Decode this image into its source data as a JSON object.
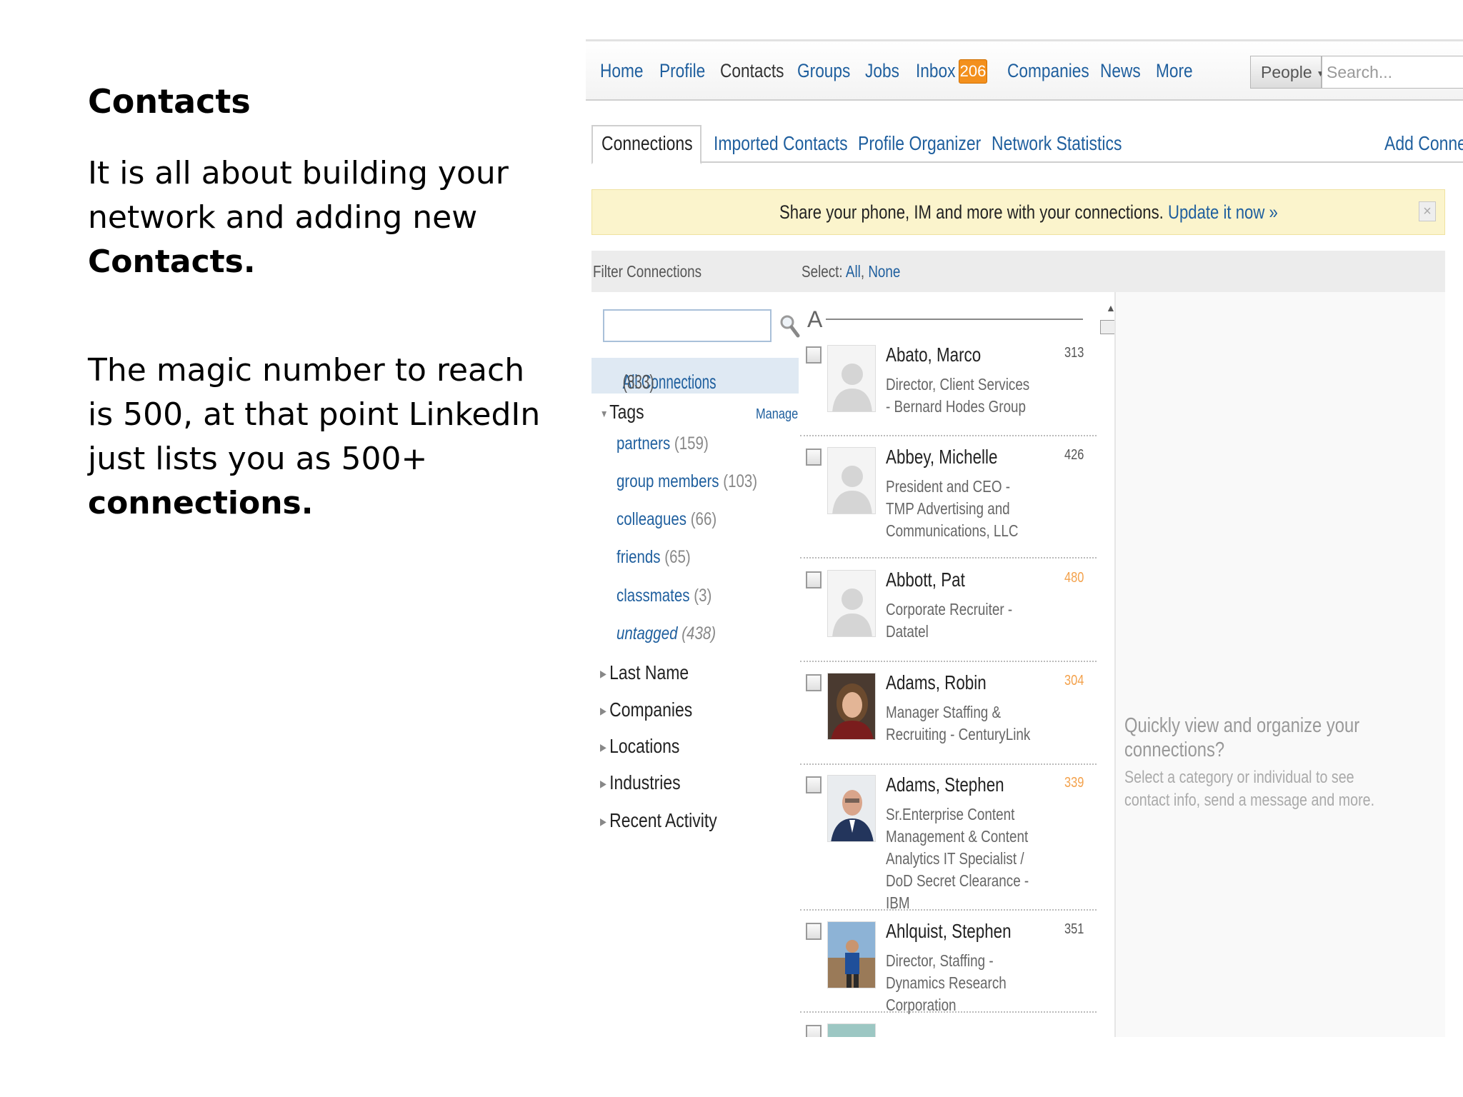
{
  "slide": {
    "title": "Contacts",
    "para1_text": "It is all about building your network and adding new ",
    "para1_bold": "Contacts.",
    "para2_text": "The magic number to reach is 500, at that point LinkedIn just lists you as 500+ ",
    "para2_bold": "connections."
  },
  "nav": {
    "items": [
      "Home",
      "Profile",
      "Contacts",
      "Groups",
      "Jobs",
      "Inbox",
      "Companies",
      "News",
      "More"
    ],
    "inbox_count": "206",
    "people_label": "People",
    "search_placeholder": "Search..."
  },
  "subtabs": {
    "items": [
      "Connections",
      "Imported Contacts",
      "Profile Organizer",
      "Network Statistics",
      "Add Connec"
    ]
  },
  "banner": {
    "text": "Share your phone, IM and more with your connections.",
    "link": "Update it now »",
    "close": "×"
  },
  "filterbar": {
    "filter_label": "Filter Connections",
    "select_label": "Select:",
    "select_all": "All",
    "select_none": "None"
  },
  "sidebar": {
    "all_connections": "All Connections",
    "all_count": "(833)",
    "tags_label": "Tags",
    "manage": "Manage",
    "tags": [
      {
        "label": "partners",
        "count": "(159)"
      },
      {
        "label": "group members",
        "count": "(103)"
      },
      {
        "label": "colleagues",
        "count": "(66)"
      },
      {
        "label": "friends",
        "count": "(65)"
      },
      {
        "label": "classmates",
        "count": "(3)"
      },
      {
        "label": "untagged",
        "count": "(438)"
      }
    ],
    "facets": [
      "Last Name",
      "Companies",
      "Locations",
      "Industries",
      "Recent Activity"
    ]
  },
  "list": {
    "letter": "A",
    "connections": [
      {
        "name": "Abato, Marco",
        "title": "Director, Client Services - Bernard Hodes Group",
        "count": "313",
        "count_color": "#555555"
      },
      {
        "name": "Abbey, Michelle",
        "title": "President and CEO - TMP Advertising and Communications, LLC",
        "count": "426",
        "count_color": "#555555"
      },
      {
        "name": "Abbott, Pat",
        "title": "Corporate Recruiter - Datatel",
        "count": "480",
        "count_color": "#f3a14b"
      },
      {
        "name": "Adams, Robin",
        "title": "Manager Staffing & Recruiting - CenturyLink",
        "count": "304",
        "count_color": "#f3a14b"
      },
      {
        "name": "Adams, Stephen",
        "title": "Sr.Enterprise Content Management & Content Analytics IT Specialist / DoD Secret Clearance - IBM",
        "count": "339",
        "count_color": "#f3a14b"
      },
      {
        "name": "Ahlquist, Stephen",
        "title": "Director, Staffing - Dynamics Research Corporation",
        "count": "351",
        "count_color": "#555555"
      }
    ]
  },
  "rightpane": {
    "title": "Quickly view and organize your connections?",
    "body": "Select a category or individual to see contact info, send a message and more."
  }
}
